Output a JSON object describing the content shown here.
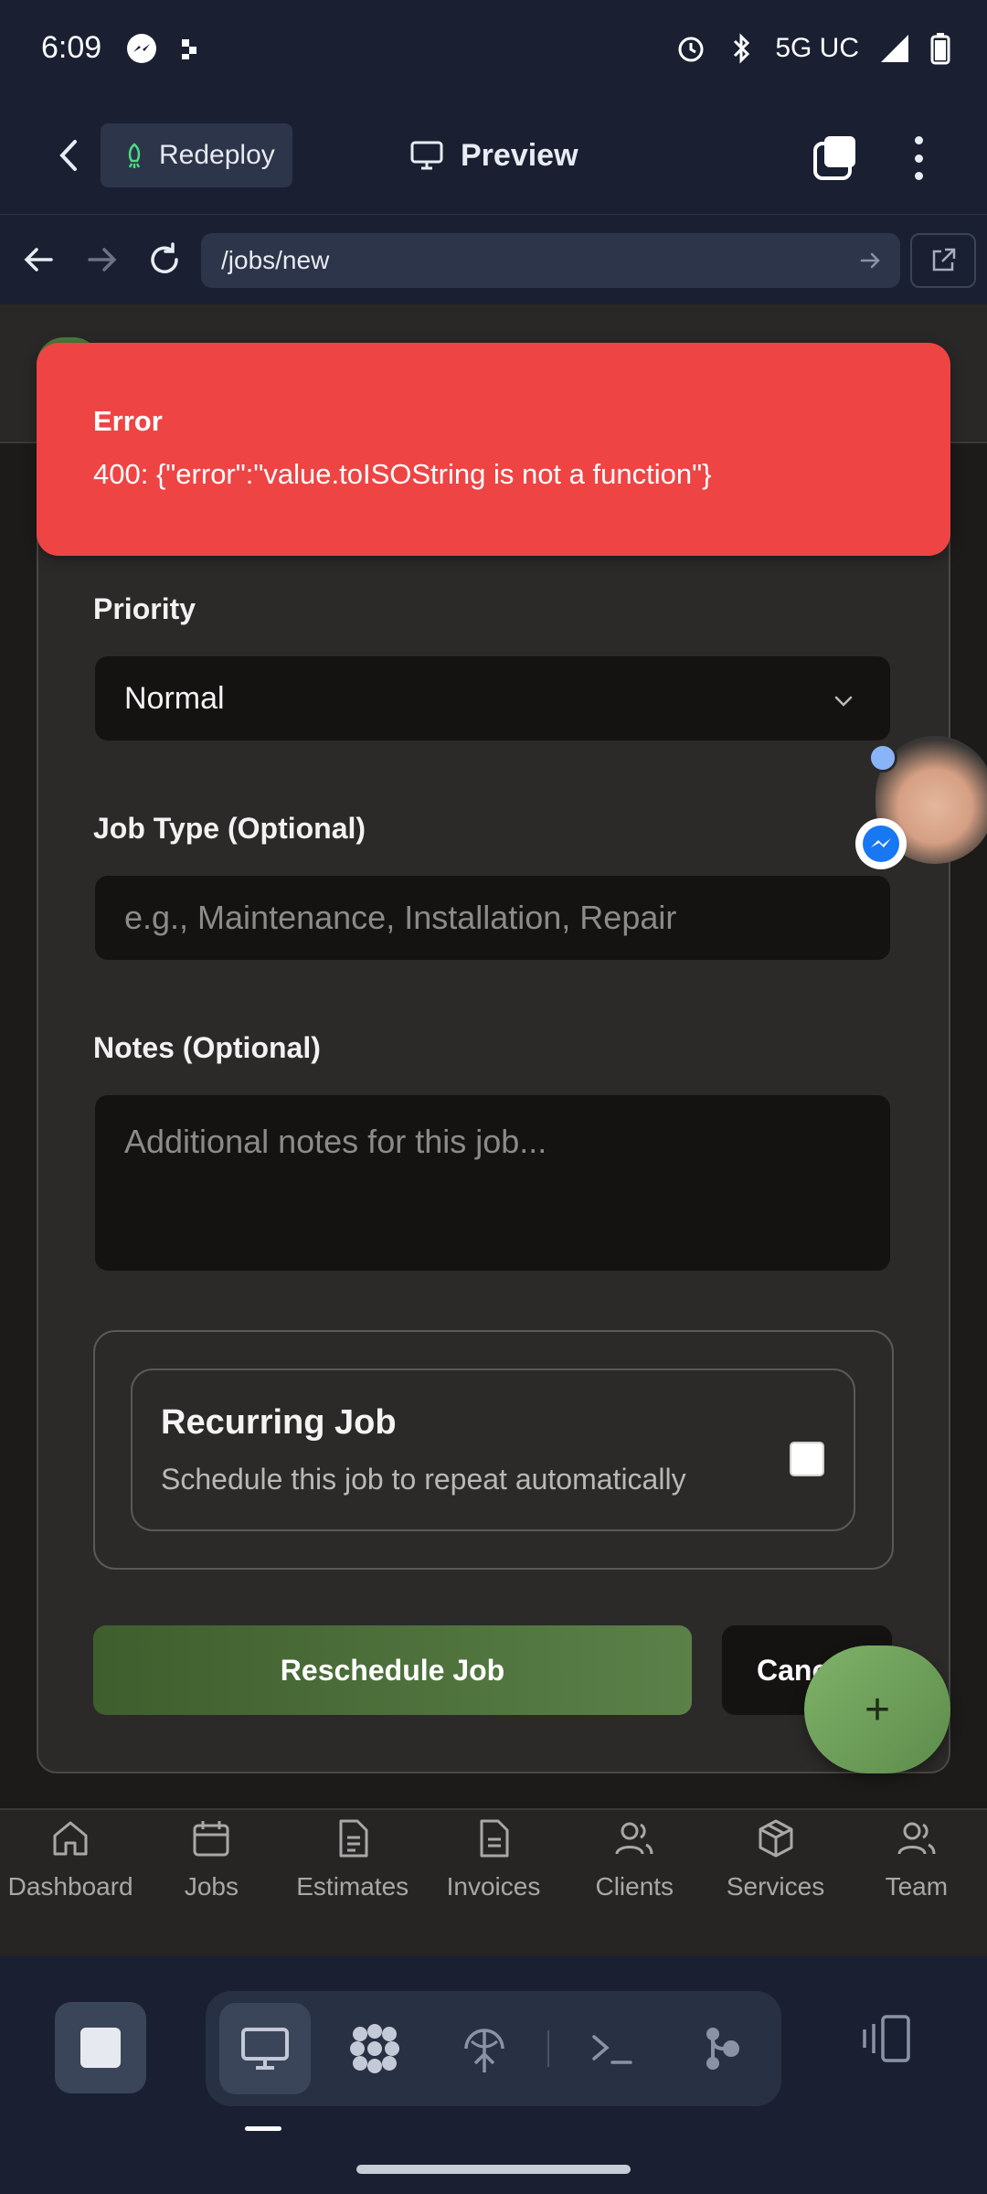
{
  "status_bar": {
    "time": "6:09",
    "network": "5G UC"
  },
  "app_bar": {
    "redeploy_label": "Redeploy",
    "title": "Preview"
  },
  "browser": {
    "url": "/jobs/new"
  },
  "error": {
    "title": "Error",
    "message": "400: {\"error\":\"value.toISOString is not a function\"}"
  },
  "form": {
    "priority_label": "Priority",
    "priority_value": "Normal",
    "job_type_label": "Job Type (Optional)",
    "job_type_placeholder": "e.g., Maintenance, Installation, Repair",
    "notes_label": "Notes (Optional)",
    "notes_placeholder": "Additional notes for this job...",
    "recurring_title": "Recurring Job",
    "recurring_desc": "Schedule this job to repeat automatically",
    "recurring_checked": false,
    "submit_label": "Reschedule Job",
    "cancel_label": "Cancel",
    "fab_label": "+"
  },
  "bottom_nav": {
    "items": [
      {
        "label": "Dashboard",
        "icon": "home-icon"
      },
      {
        "label": "Jobs",
        "icon": "calendar-icon"
      },
      {
        "label": "Estimates",
        "icon": "document-icon"
      },
      {
        "label": "Invoices",
        "icon": "invoice-icon"
      },
      {
        "label": "Clients",
        "icon": "users-icon"
      },
      {
        "label": "Services",
        "icon": "package-icon"
      },
      {
        "label": "Team",
        "icon": "team-icon"
      }
    ]
  },
  "colors": {
    "error": "#ef4444",
    "primary": "#5b8149",
    "chrome": "#1a2032"
  }
}
